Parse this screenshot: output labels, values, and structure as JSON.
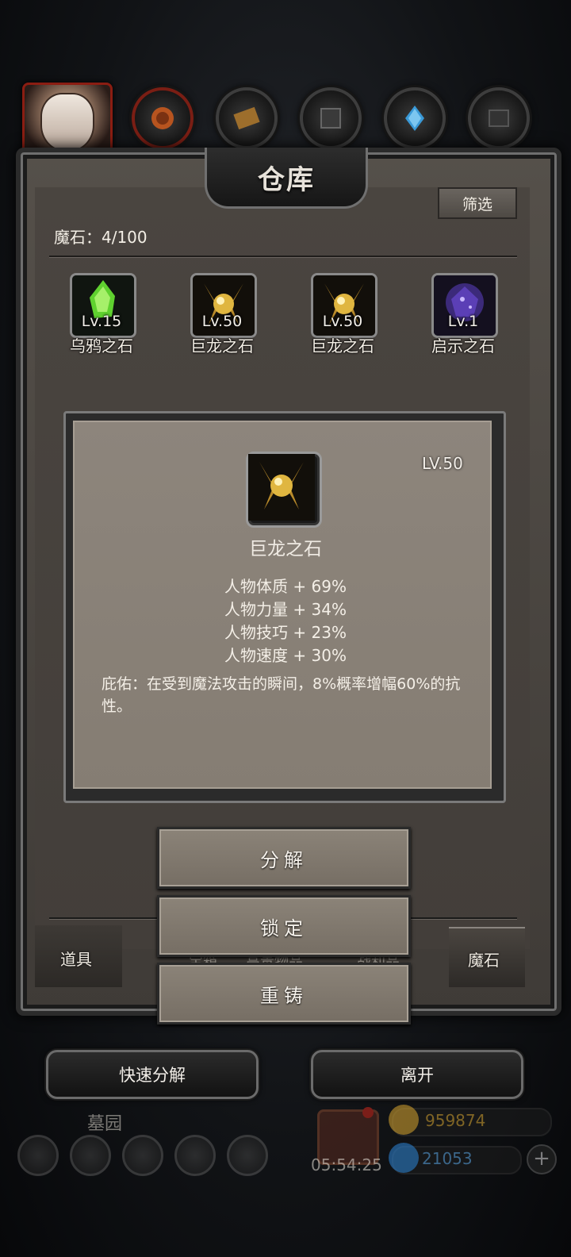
{
  "window": {
    "title": "仓库"
  },
  "toolbar": {
    "filter_label": "筛选"
  },
  "inventory": {
    "count_label": "魔石：4/100",
    "stones": [
      {
        "level": "Lv.15",
        "name": "乌鸦之石",
        "color": "#5fd12f"
      },
      {
        "level": "Lv.50",
        "name": "巨龙之石",
        "color": "#d8a630"
      },
      {
        "level": "Lv.50",
        "name": "巨龙之石",
        "color": "#d8a630"
      },
      {
        "level": "Lv.1",
        "name": "启示之石",
        "color": "#5b3fb6"
      }
    ]
  },
  "detail": {
    "level": "LV.50",
    "name": "巨龙之石",
    "stats": [
      "人物体质 + 69%",
      "人物力量 + 34%",
      "人物技巧 + 23%",
      "人物速度 + 30%"
    ],
    "description": "庇佑：在受到魔法攻击的瞬间，8%概率增幅60%的抗性。"
  },
  "actions": {
    "decompose": "分解",
    "lock": "锁定",
    "recast": "重铸"
  },
  "tabs": {
    "items": "道具",
    "magic_stone": "魔石",
    "hidden_1": "宝箱",
    "hidden_2": "高贵物品",
    "hidden_3": "战利品"
  },
  "buttons": {
    "quick_decompose": "快速分解",
    "leave": "离开"
  },
  "hud": {
    "location": "墓园",
    "timer": "05:54:25",
    "gold": "959874",
    "gems": "21053",
    "add_symbol": "+"
  },
  "colors": {
    "accent_gold": "#d8a630",
    "gem_blue": "#2e86d8",
    "notification_red": "#d2281c"
  }
}
